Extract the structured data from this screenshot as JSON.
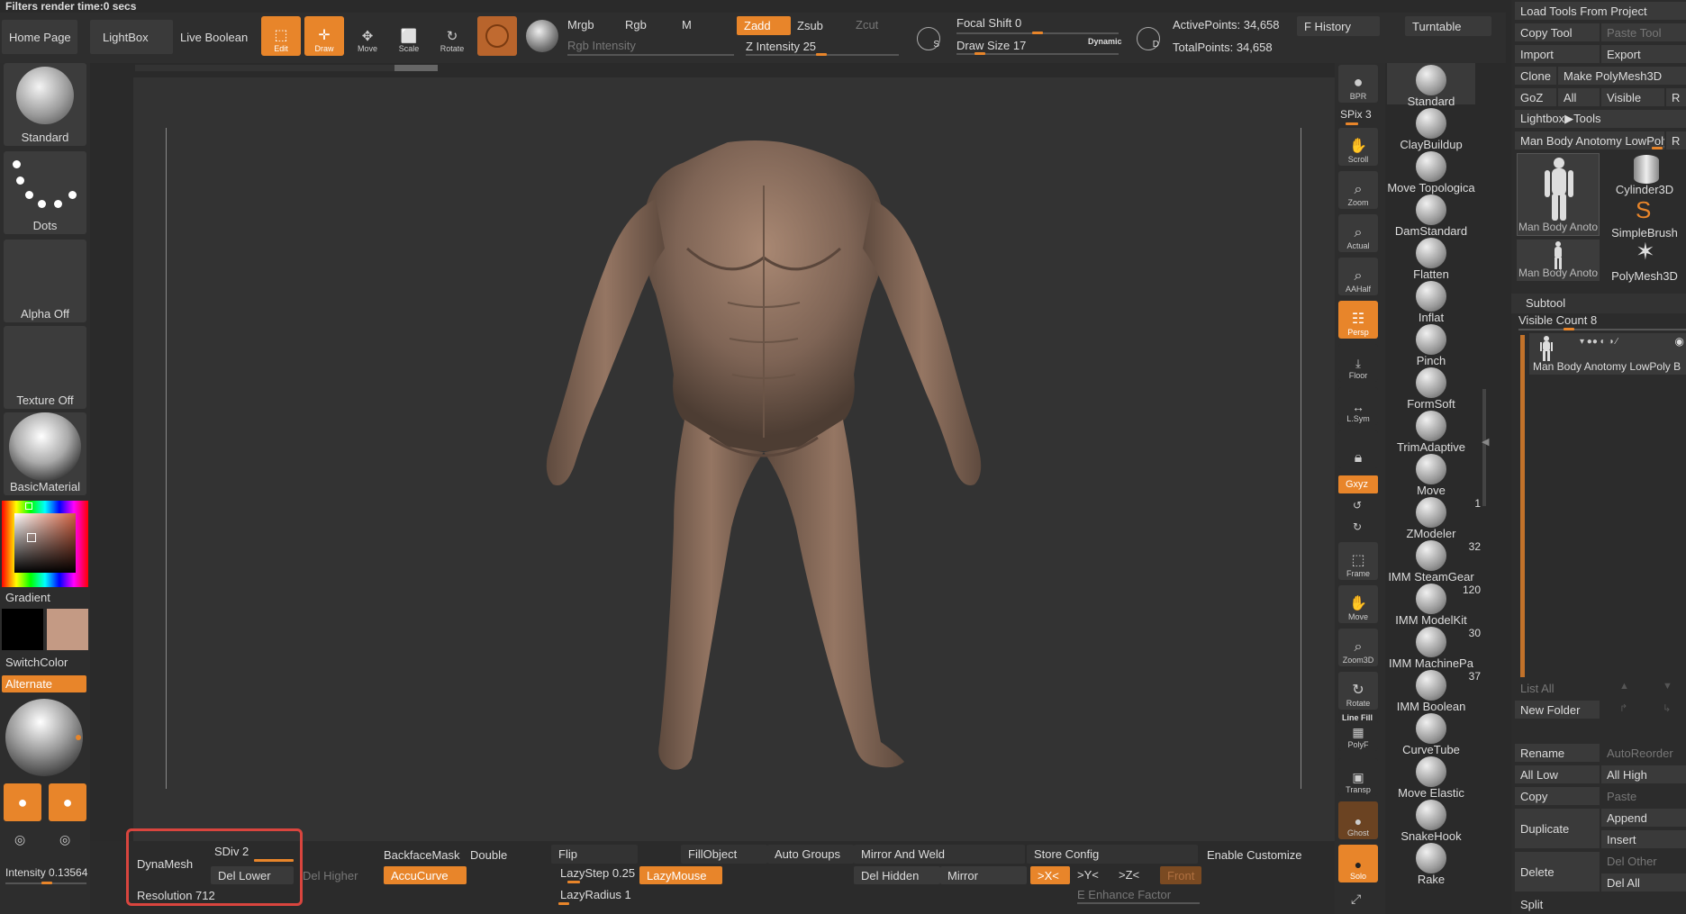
{
  "status": {
    "text": "Filters render time:0 secs"
  },
  "topbar": {
    "home_page": "Home Page",
    "lightbox": "LightBox",
    "live_boolean": "Live Boolean",
    "edit": "Edit",
    "draw": "Draw",
    "move": "Move",
    "scale": "Scale",
    "rotate": "Rotate",
    "mrgb": "Mrgb",
    "rgb": "Rgb",
    "m": "M",
    "rgb_intensity": "Rgb Intensity",
    "zadd": "Zadd",
    "zsub": "Zsub",
    "zcut": "Zcut",
    "z_intensity": "Z Intensity 25",
    "focal_shift": "Focal Shift 0",
    "draw_size": "Draw Size 17",
    "dynamic": "Dynamic",
    "active_points": "ActivePoints: 34,658",
    "total_points": "TotalPoints: 34,658",
    "f_history": "F History",
    "turntable": "Turntable"
  },
  "left": {
    "brush": "Standard",
    "stroke": "Dots",
    "alpha": "Alpha Off",
    "texture": "Texture Off",
    "material": "BasicMaterial",
    "gradient": "Gradient",
    "switch_color": "SwitchColor",
    "alternate": "Alternate",
    "intensity": "Intensity 0.13564",
    "main_color": "#c49a84"
  },
  "bottom": {
    "dynamesh": "DynaMesh",
    "sdiv": "SDiv 2",
    "del_higher": "Del Higher",
    "del_lower": "Del Lower",
    "resolution": "Resolution 712",
    "backface_mask": "BackfaceMask",
    "double": "Double",
    "accucurve": "AccuCurve",
    "flip": "Flip",
    "lazystep": "LazyStep 0.25",
    "lazyradius": "LazyRadius 1",
    "lazymouse": "LazyMouse",
    "fill_object": "FillObject",
    "auto_groups": "Auto Groups",
    "mirror_weld": "Mirror And Weld",
    "del_hidden": "Del Hidden",
    "mirror": "Mirror",
    "store_config": "Store Config",
    "x_sym": ">X<",
    "y_sym": ">Y<",
    "z_sym": ">Z<",
    "front": "Front",
    "enhance": "E Enhance Factor",
    "enable_customize": "Enable Customize"
  },
  "rightnav": {
    "bpr": "BPR",
    "spix": "SPix 3",
    "scroll": "Scroll",
    "zoom": "Zoom",
    "actual": "Actual",
    "aahalf": "AAHalf",
    "persp": "Persp",
    "floor": "Floor",
    "lsym": "L.Sym",
    "xyz": "Gxyz",
    "frame": "Frame",
    "move": "Move",
    "zoom3d": "Zoom3D",
    "rotate": "Rotate",
    "line_fill": "Line Fill",
    "polyf": "PolyF",
    "transp": "Transp",
    "ghost": "Ghost",
    "solo": "Solo"
  },
  "brushes": [
    {
      "name": "Standard",
      "count": ""
    },
    {
      "name": "ClayBuildup",
      "count": ""
    },
    {
      "name": "Move Topologica",
      "count": ""
    },
    {
      "name": "DamStandard",
      "count": ""
    },
    {
      "name": "Flatten",
      "count": ""
    },
    {
      "name": "Inflat",
      "count": ""
    },
    {
      "name": "Pinch",
      "count": ""
    },
    {
      "name": "FormSoft",
      "count": ""
    },
    {
      "name": "TrimAdaptive",
      "count": ""
    },
    {
      "name": "Move",
      "count": ""
    },
    {
      "name": "ZModeler",
      "count": "1"
    },
    {
      "name": "IMM SteamGear",
      "count": "32"
    },
    {
      "name": "IMM ModelKit",
      "count": "120"
    },
    {
      "name": "IMM MachinePa",
      "count": "30"
    },
    {
      "name": "IMM Boolean",
      "count": "37"
    },
    {
      "name": "CurveTube",
      "count": ""
    },
    {
      "name": "Move Elastic",
      "count": ""
    },
    {
      "name": "SnakeHook",
      "count": ""
    },
    {
      "name": "Rake",
      "count": ""
    }
  ],
  "tool": {
    "load_tools": "Load Tools From Project",
    "copy_tool": "Copy Tool",
    "paste_tool": "Paste Tool",
    "import": "Import",
    "export": "Export",
    "clone": "Clone",
    "make_polymesh": "Make PolyMesh3D",
    "goz": "GoZ",
    "all": "All",
    "visible": "Visible",
    "r": "R",
    "lightbox_tools": "Lightbox▶Tools",
    "current_tool": "Man Body Anotomy LowPoly I",
    "thumbs": [
      "Man Body Anoto",
      "Cylinder3D",
      "SimpleBrush",
      "Man Body Anoto",
      "PolyMesh3D"
    ]
  },
  "subtool": {
    "title": "Subtool",
    "visible_count": "Visible Count 8",
    "item": "Man Body Anotomy LowPoly B",
    "list_all": "List All",
    "new_folder": "New Folder",
    "rename": "Rename",
    "auto_reorder": "AutoReorder",
    "all_low": "All Low",
    "all_high": "All High",
    "copy": "Copy",
    "paste": "Paste",
    "duplicate": "Duplicate",
    "append": "Append",
    "insert": "Insert",
    "delete": "Delete",
    "del_other": "Del Other",
    "del_all": "Del All",
    "split": "Split"
  }
}
